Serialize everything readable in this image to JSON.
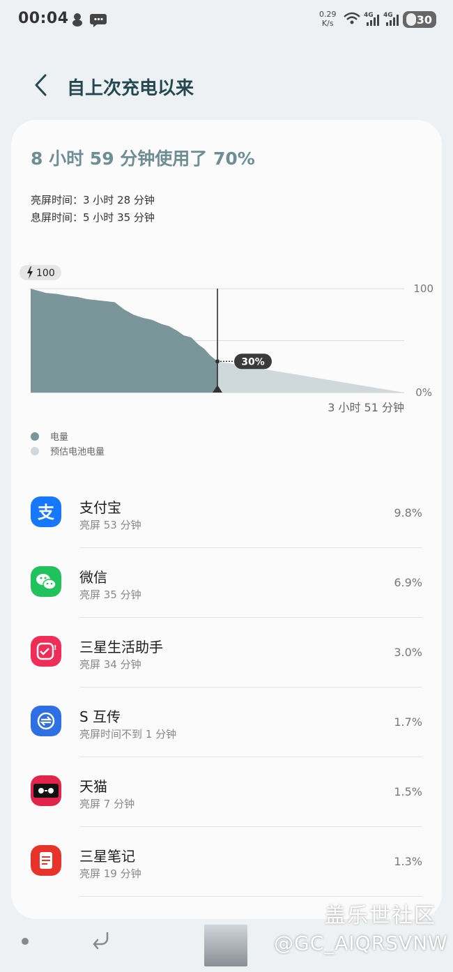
{
  "status_bar": {
    "time": "00:04",
    "net_speed": "0.29",
    "net_unit": "K/s",
    "net_label_1": "4G",
    "net_label_2": "4G",
    "battery": "30"
  },
  "header": {
    "title": "自上次充电以来"
  },
  "summary": {
    "usage": "8 小时 59 分钟使用了 70%",
    "screen_on": "亮屏时间：3 小时 28 分钟",
    "screen_off": "息屏时间：5 小时 35 分钟"
  },
  "chart_data": {
    "type": "area",
    "start_badge": "100",
    "ylabels": [
      "100",
      "0%"
    ],
    "ylim": [
      0,
      100
    ],
    "current_label": "30%",
    "remaining_label": "3 小时 51 分钟",
    "series": [
      {
        "name": "电量",
        "color": "#7b969b",
        "x": [
          0,
          0.04,
          0.08,
          0.14,
          0.2,
          0.25,
          0.3,
          0.35,
          0.4,
          0.45,
          0.5,
          0.55,
          0.6,
          0.65,
          0.7,
          0.74,
          0.78,
          0.82,
          0.86,
          0.9,
          0.93,
          0.96,
          1.0
        ],
        "values": [
          100,
          98,
          96,
          95,
          93,
          92,
          90,
          89,
          88,
          87,
          80,
          75,
          72,
          70,
          66,
          64,
          60,
          55,
          53,
          46,
          42,
          36,
          30
        ]
      },
      {
        "name": "预估电池电量",
        "color": "#cfd8da",
        "x": [
          1.0,
          2.0
        ],
        "values": [
          30,
          0
        ]
      }
    ]
  },
  "legend": [
    {
      "label": "电量",
      "color": "#7b969b"
    },
    {
      "label": "预估电池电量",
      "color": "#cfd8da"
    }
  ],
  "apps": [
    {
      "name": "支付宝",
      "sub": "亮屏 53 分钟",
      "pct": "9.8%",
      "icon_color": "#1677ff"
    },
    {
      "name": "微信",
      "sub": "亮屏 35 分钟",
      "pct": "6.9%",
      "icon_color": "#21c25e"
    },
    {
      "name": "三星生活助手",
      "sub": "亮屏 34 分钟",
      "pct": "3.0%",
      "icon_color": "#ef2d56"
    },
    {
      "name": "S 互传",
      "sub": "亮屏时间不到 1 分钟",
      "pct": "1.7%",
      "icon_color": "#2f6fe4"
    },
    {
      "name": "天猫",
      "sub": "亮屏 7 分钟",
      "pct": "1.5%",
      "icon_color": "#e2234a"
    },
    {
      "name": "三星笔记",
      "sub": "亮屏 19 分钟",
      "pct": "1.3%",
      "icon_color": "#e8332b"
    }
  ],
  "watermark": {
    "title": "盖乐世社区",
    "user": "@GC_AIQRSVNW"
  }
}
